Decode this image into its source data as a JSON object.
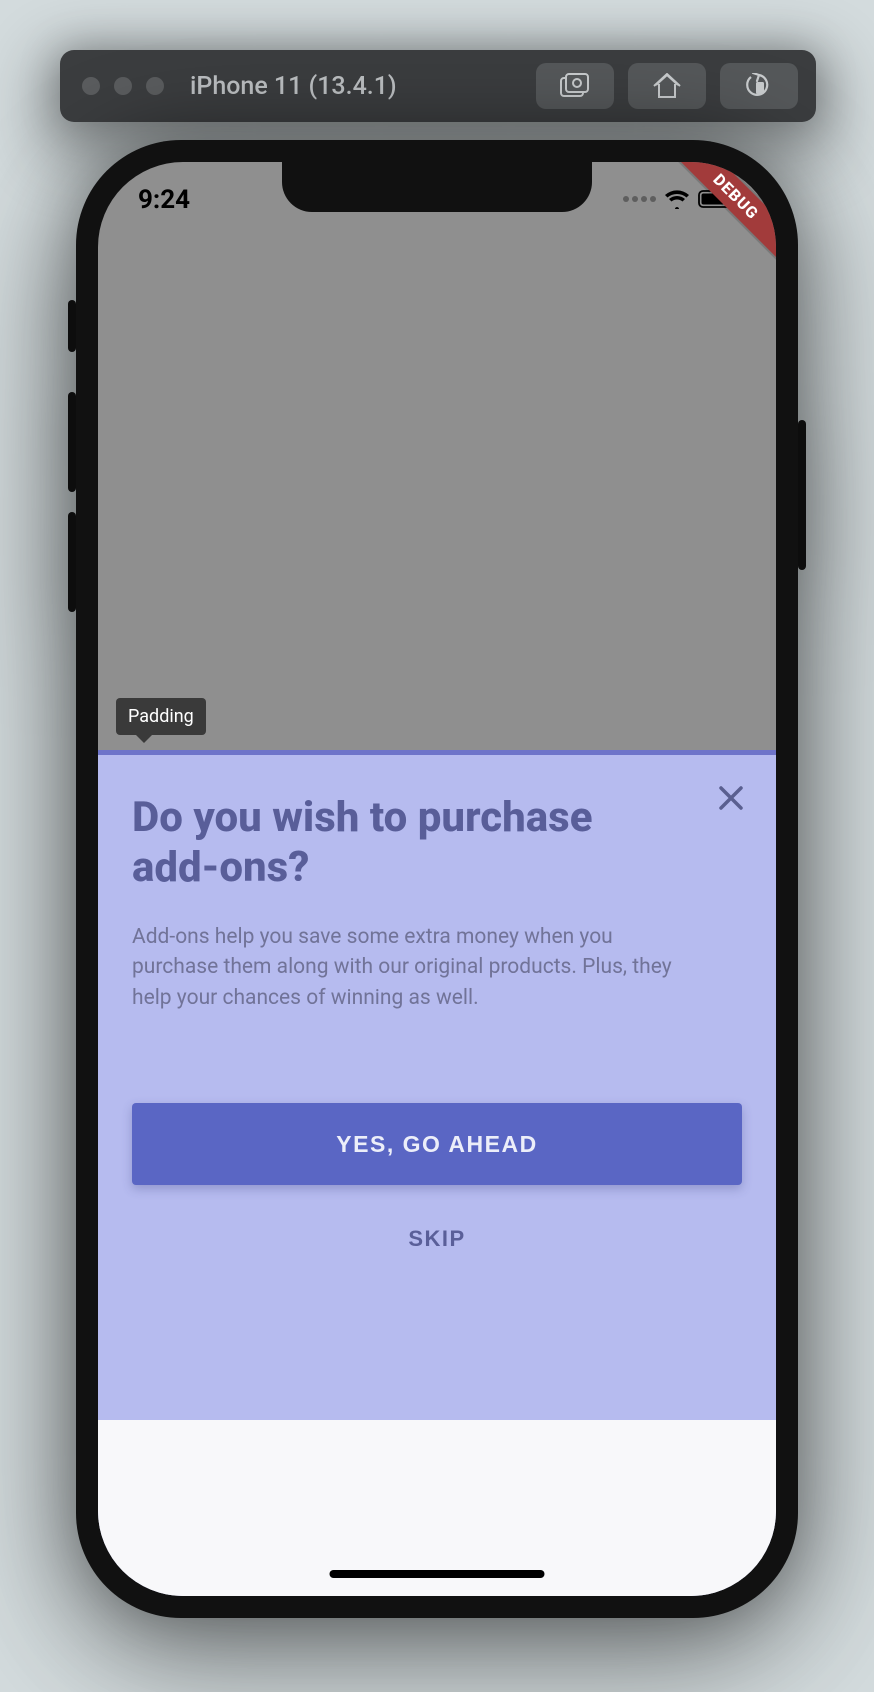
{
  "window": {
    "title": "iPhone 11 (13.4.1)",
    "toolbar_icons": [
      "screenshot",
      "home",
      "rotate"
    ]
  },
  "status_bar": {
    "time": "9:24",
    "debug_label": "DEBUG"
  },
  "inspector": {
    "tooltip": "Padding"
  },
  "dialog": {
    "title": "Do you wish to purchase add-ons?",
    "body": "Add-ons help you save some extra money when you purchase them along with our original products. Plus, they help your chances of winning as well.",
    "primary_label": "YES, GO AHEAD",
    "secondary_label": "SKIP"
  }
}
